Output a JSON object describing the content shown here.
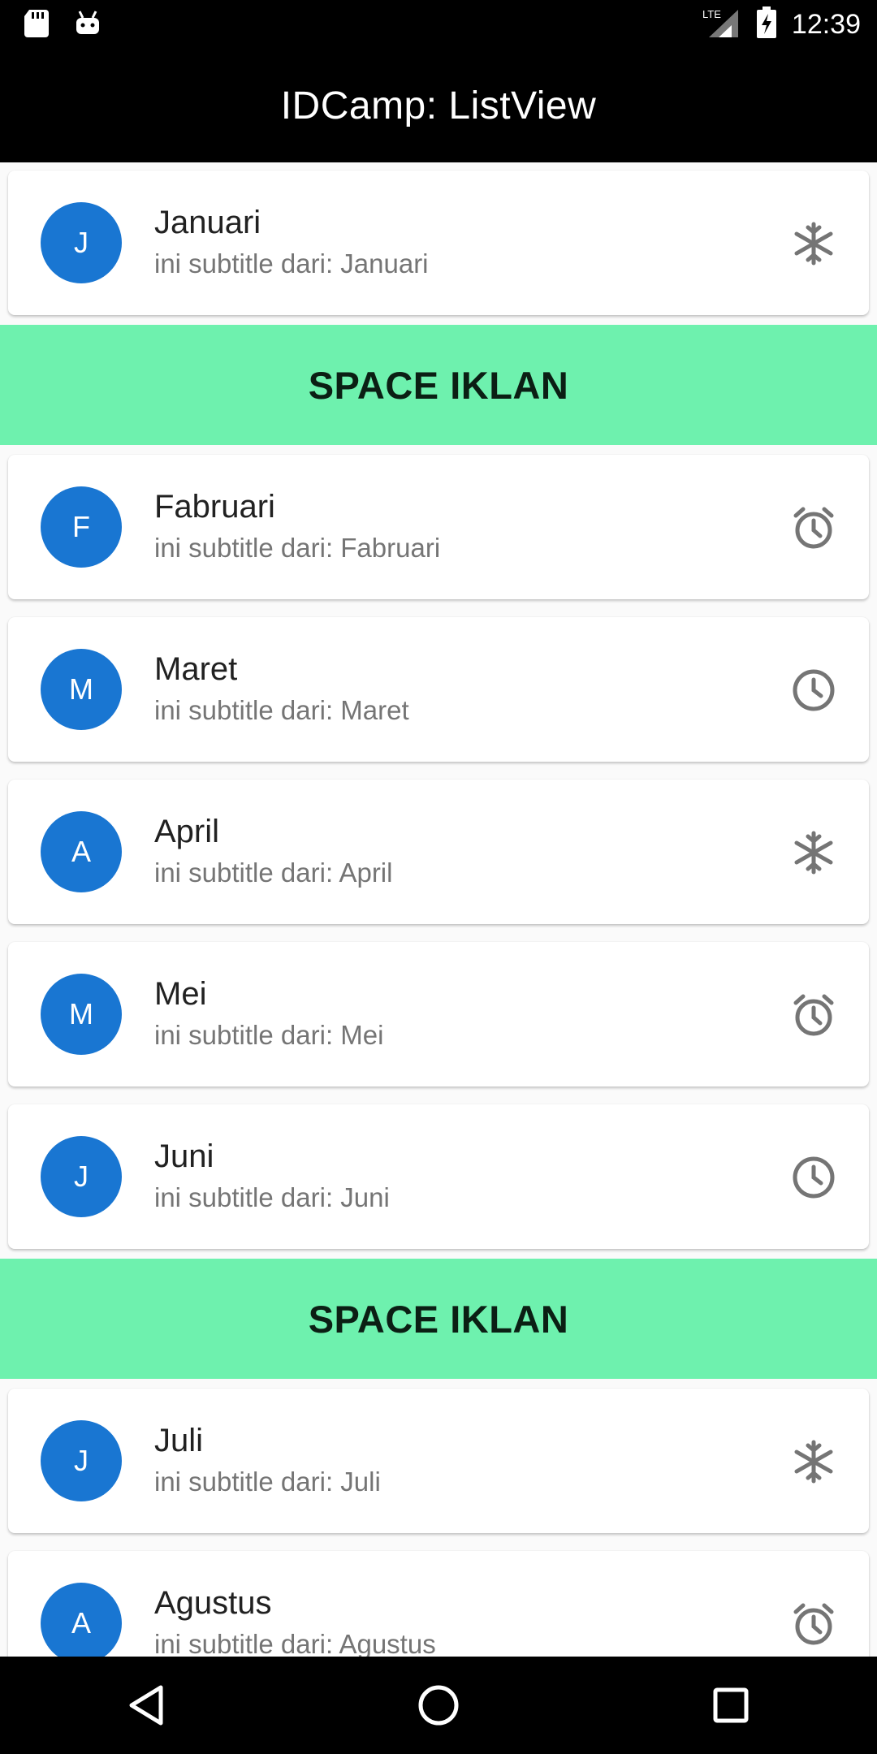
{
  "status_bar": {
    "time": "12:39",
    "network": "LTE"
  },
  "app_bar": {
    "title": "IDCamp: ListView"
  },
  "ad_label": "SPACE IKLAN",
  "items": [
    {
      "initial": "J",
      "title": "Januari",
      "subtitle": "ini subtitle dari: Januari",
      "icon": "snowflake-icon"
    },
    {
      "initial": "F",
      "title": "Fabruari",
      "subtitle": "ini subtitle dari: Fabruari",
      "icon": "alarm-icon"
    },
    {
      "initial": "M",
      "title": "Maret",
      "subtitle": "ini subtitle dari: Maret",
      "icon": "clock-icon"
    },
    {
      "initial": "A",
      "title": "April",
      "subtitle": "ini subtitle dari: April",
      "icon": "snowflake-icon"
    },
    {
      "initial": "M",
      "title": "Mei",
      "subtitle": "ini subtitle dari: Mei",
      "icon": "alarm-icon"
    },
    {
      "initial": "J",
      "title": "Juni",
      "subtitle": "ini subtitle dari: Juni",
      "icon": "clock-icon"
    },
    {
      "initial": "J",
      "title": "Juli",
      "subtitle": "ini subtitle dari: Juli",
      "icon": "snowflake-icon"
    },
    {
      "initial": "A",
      "title": "Agustus",
      "subtitle": "ini subtitle dari: Agustus",
      "icon": "alarm-icon"
    }
  ],
  "colors": {
    "avatar": "#1976d2",
    "ad_background": "#6ef1ae",
    "icon": "#757575"
  }
}
